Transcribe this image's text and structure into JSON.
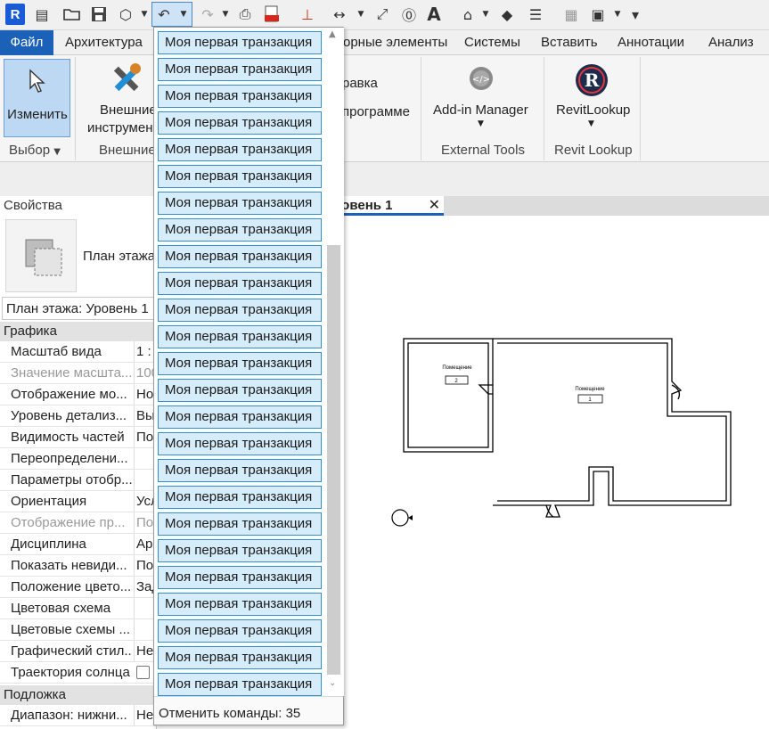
{
  "toolbar": {
    "app_letter": "R",
    "icons": [
      "open-icon",
      "save-icon",
      "sync-icon",
      "undo-icon",
      "redo-icon",
      "print-icon",
      "pdf-export-icon",
      "measure-icon",
      "dimension-icon",
      "tag-icon",
      "text-icon",
      "view-3d-icon",
      "section-icon",
      "thin-lines-icon",
      "close-hidden-icon",
      "switch-windows-icon",
      "customize-icon"
    ]
  },
  "tabs": {
    "file": "Файл",
    "architecture": "Архитектура",
    "precast": "орные элементы",
    "systems": "Системы",
    "insert": "Вставить",
    "annotate": "Аннотации",
    "analyze": "Анализ"
  },
  "ribbon": {
    "modify": "Изменить",
    "select_panel": "Выбор",
    "external_line1": "Внешние",
    "external_line2": "инструмен",
    "external_panel": "Внешние",
    "help_line1": "равка",
    "help_line2": "программе",
    "addin_manager": "Add-in Manager",
    "external_tools_panel": "External Tools",
    "revit_lookup": "RevitLookup",
    "revit_lookup_panel": "Revit Lookup"
  },
  "properties": {
    "title": "Свойства",
    "type_name": "План этажа",
    "type_selector": "План этажа: Уровень 1",
    "category_graphics": "Графика",
    "category_underlay": "Подложка",
    "rows": [
      {
        "name": "Масштаб вида",
        "value": "1 :"
      },
      {
        "name": "Значение масшта...",
        "value": "100"
      },
      {
        "name": "Отображение мо...",
        "value": "Но"
      },
      {
        "name": "Уровень детализ...",
        "value": "Вы"
      },
      {
        "name": "Видимость частей",
        "value": "По"
      },
      {
        "name": "Переопределени...",
        "value": ""
      },
      {
        "name": "Параметры отобр...",
        "value": ""
      },
      {
        "name": "Ориентация",
        "value": "Усл"
      },
      {
        "name": "Отображение пр...",
        "value": "По"
      },
      {
        "name": "Дисциплина",
        "value": "Ар"
      },
      {
        "name": "Показать невиди...",
        "value": "По"
      },
      {
        "name": "Положение цвето...",
        "value": "Зад"
      },
      {
        "name": "Цветовая схема",
        "value": ""
      },
      {
        "name": "Цветовые схемы ...",
        "value": ""
      },
      {
        "name": "Графический стил...",
        "value": "Не"
      },
      {
        "name": "Траектория солнца",
        "value": ""
      },
      {
        "name": "Диапазон: нижни...",
        "value": "Не"
      }
    ]
  },
  "view": {
    "tab_label": "ровень 1",
    "room1_name": "Помещение",
    "room1_number": "1",
    "room2_name": "Помещение",
    "room2_number": "2"
  },
  "undo_dropdown": {
    "items": [
      "Моя первая транзакция",
      "Моя первая транзакция",
      "Моя первая транзакция",
      "Моя первая транзакция",
      "Моя первая транзакция",
      "Моя первая транзакция",
      "Моя первая транзакция",
      "Моя первая транзакция",
      "Моя первая транзакция",
      "Моя первая транзакция",
      "Моя первая транзакция",
      "Моя первая транзакция",
      "Моя первая транзакция",
      "Моя первая транзакция",
      "Моя первая транзакция",
      "Моя первая транзакция",
      "Моя первая транзакция",
      "Моя первая транзакция",
      "Моя первая транзакция",
      "Моя первая транзакция",
      "Моя первая транзакция",
      "Моя первая транзакция",
      "Моя первая транзакция",
      "Моя первая транзакция",
      "Моя первая транзакция"
    ],
    "footer": "Отменить команды: 35"
  },
  "colors": {
    "accent": "#1c61b8",
    "item_fill": "#d5ecfb",
    "item_border": "#2f8fd0"
  }
}
